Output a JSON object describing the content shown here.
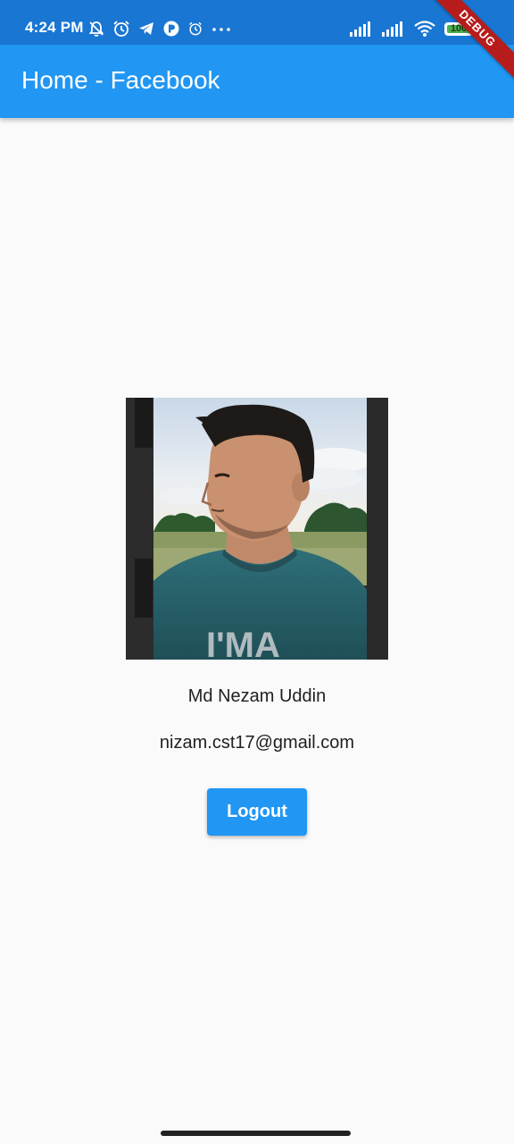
{
  "status_bar": {
    "time": "4:24 PM",
    "battery": "100",
    "left_icons": [
      "notifications-off-icon",
      "alarm-icon",
      "telegram-icon",
      "app-icon",
      "alarm-small-icon",
      "more-icon"
    ],
    "right_icons": [
      "signal-icon",
      "signal-icon",
      "wifi-icon",
      "battery-icon"
    ]
  },
  "debug_banner": "DEBUG",
  "app_bar": {
    "title": "Home - Facebook"
  },
  "profile": {
    "name": "Md Nezam Uddin",
    "email": "nizam.cst17@gmail.com",
    "photo_text": "I'MA"
  },
  "actions": {
    "logout_label": "Logout"
  },
  "colors": {
    "primary": "#2196f3",
    "status_bar": "#1976d2",
    "background": "#fafafa",
    "debug_ribbon": "#b71c1c"
  }
}
